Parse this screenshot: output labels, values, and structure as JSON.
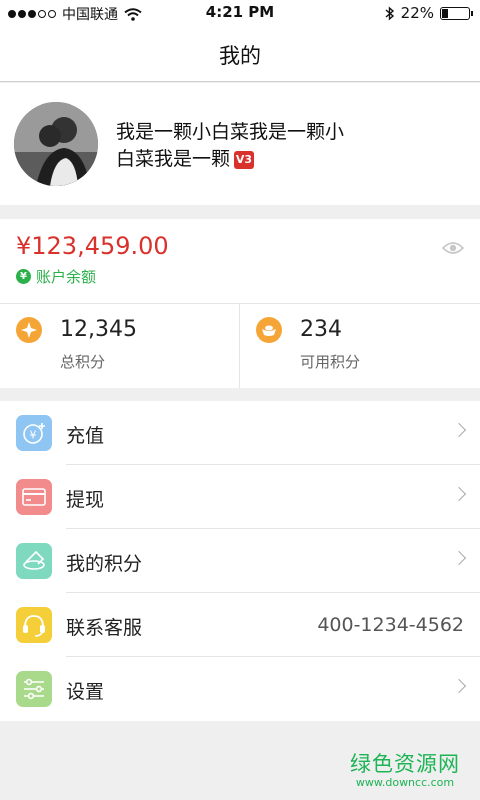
{
  "status_bar": {
    "carrier": "中国联通",
    "time": "4:21 PM",
    "battery_percent": "22%",
    "battery_level": 0.22
  },
  "nav": {
    "title": "我的"
  },
  "profile": {
    "name": "我是一颗小白菜我是一颗小白菜我是一颗",
    "level_badge": "V3"
  },
  "balance": {
    "amount": "¥123,459.00",
    "label": "账户余额",
    "yen_icon": "¥"
  },
  "points": {
    "total": {
      "value": "12,345",
      "label": "总积分"
    },
    "available": {
      "value": "234",
      "label": "可用积分"
    }
  },
  "menu": [
    {
      "label": "充值",
      "icon": "recharge-icon",
      "color": "#8ec5f2"
    },
    {
      "label": "提现",
      "icon": "withdraw-icon",
      "color": "#f28b8b"
    },
    {
      "label": "我的积分",
      "icon": "points-icon",
      "color": "#7fd9bf"
    },
    {
      "label": "联系客服",
      "icon": "service-icon",
      "color": "#f5cf3a",
      "value": "400-1234-4562"
    },
    {
      "label": "设置",
      "icon": "settings-icon",
      "color": "#a9d98a"
    }
  ],
  "watermark": {
    "title": "绿色资源网",
    "url": "www.downcc.com"
  },
  "colors": {
    "accent_red": "#d9312b",
    "accent_green": "#2bb04a",
    "point_orange": "#f5a536"
  }
}
